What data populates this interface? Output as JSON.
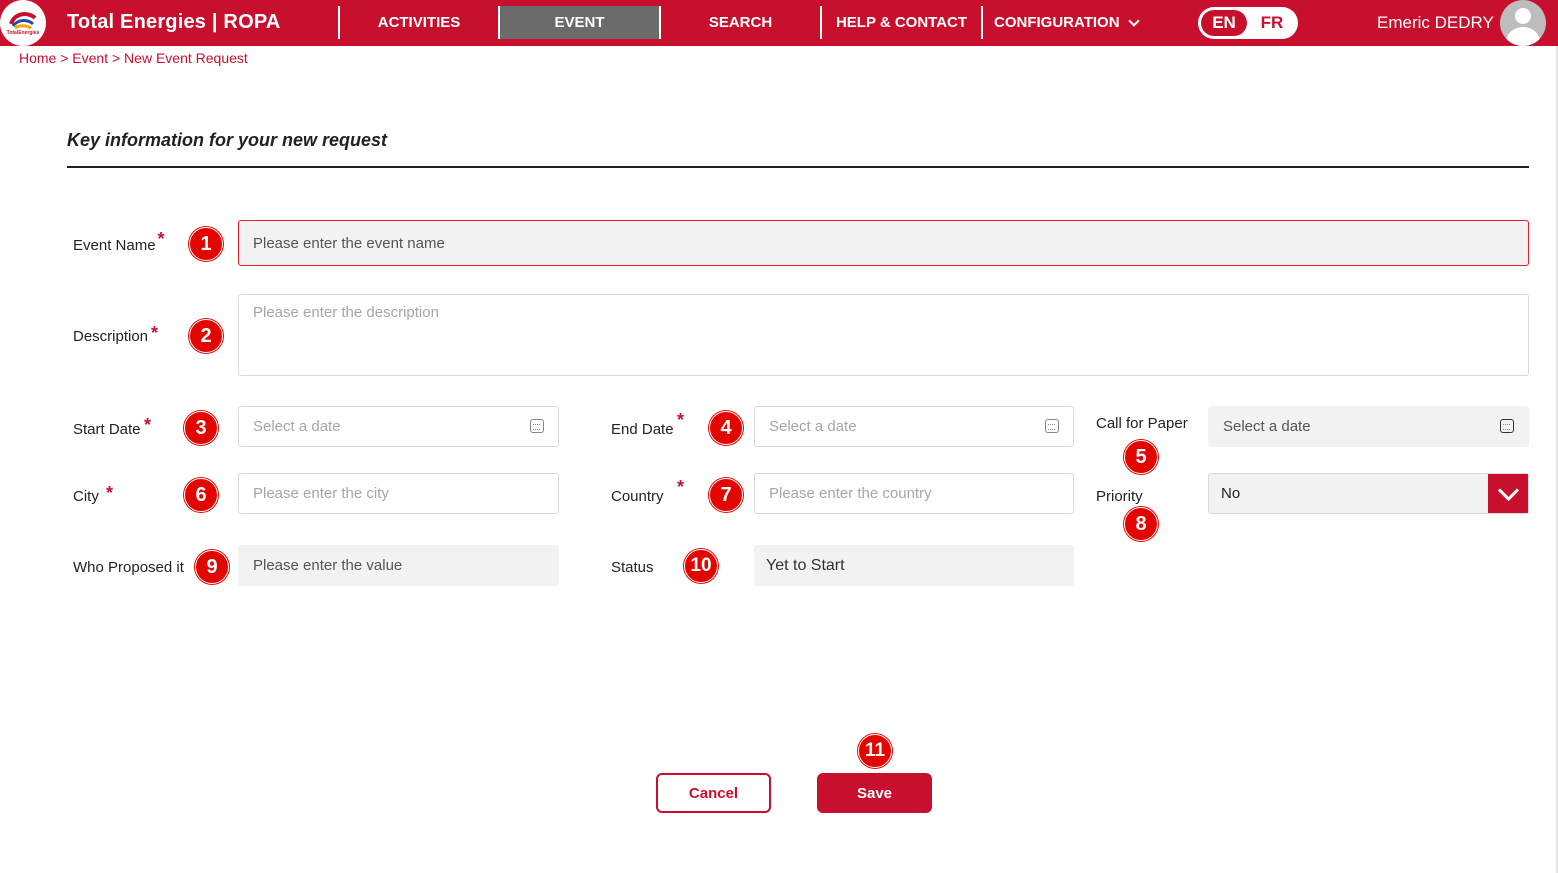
{
  "header": {
    "logo_text": "TotalEnergies",
    "brand": "Total Energies | ROPA",
    "nav": [
      {
        "label": "ACTIVITIES"
      },
      {
        "label": "EVENT"
      },
      {
        "label": "SEARCH"
      },
      {
        "label": "HELP & CONTACT"
      },
      {
        "label": "CONFIGURATION"
      }
    ],
    "lang_en": "EN",
    "lang_fr": "FR",
    "user": "Emeric DEDRY"
  },
  "breadcrumb": "Home > Event > New Event Request",
  "section_title": "Key information for your new request",
  "required_mark": "*",
  "fields": {
    "event_name": {
      "label": "Event Name",
      "placeholder": "Please enter the event name",
      "badge": "1"
    },
    "description": {
      "label": "Description",
      "placeholder": "Please enter the description",
      "badge": "2"
    },
    "start_date": {
      "label": "Start Date",
      "placeholder": "Select a date",
      "badge": "3"
    },
    "end_date": {
      "label": "End Date",
      "placeholder": "Select a date",
      "badge": "4"
    },
    "call_for_paper": {
      "label": "Call for Paper",
      "placeholder": "Select a date",
      "badge": "5"
    },
    "city": {
      "label": "City",
      "placeholder": "Please enter the city",
      "badge": "6"
    },
    "country": {
      "label": "Country",
      "placeholder": "Please enter the country",
      "badge": "7"
    },
    "priority": {
      "label": "Priority",
      "value": "No",
      "badge": "8"
    },
    "who_proposed": {
      "label": "Who Proposed it",
      "placeholder": "Please enter the value",
      "badge": "9"
    },
    "status": {
      "label": "Status",
      "value": "Yet to Start",
      "badge": "10"
    }
  },
  "actions": {
    "cancel": "Cancel",
    "save": "Save",
    "save_badge": "11"
  },
  "colors": {
    "brand": "#c8102e",
    "badge": "#e10600",
    "active_nav": "#6b6b6b"
  }
}
